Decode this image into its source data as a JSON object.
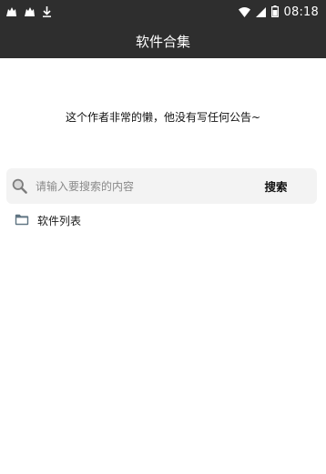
{
  "status_bar": {
    "time": "08:18",
    "icons": [
      "android-icon",
      "android-icon",
      "download-icon",
      "wifi-icon",
      "signal-icon",
      "battery-icon"
    ]
  },
  "header": {
    "title": "软件合集"
  },
  "notice": {
    "text": "这个作者非常的懒，他没有写任何公告~"
  },
  "search": {
    "placeholder": "请输入要搜索的内容",
    "value": "",
    "button_label": "搜索"
  },
  "list": {
    "items": [
      {
        "label": "软件列表",
        "icon": "folder-icon"
      }
    ]
  },
  "colors": {
    "bar_background": "#2e2e2e",
    "search_background": "#f3f3f3",
    "folder_icon": "#5f7482"
  }
}
